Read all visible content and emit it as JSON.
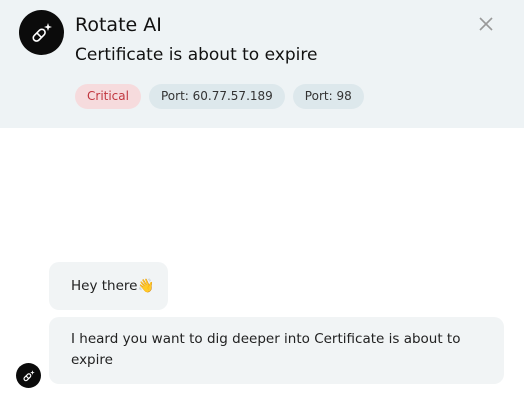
{
  "header": {
    "app_name": "Rotate AI",
    "subtitle": "Certificate is about to expire",
    "logo_icon": "pill-sparkle-icon",
    "close_icon": "close-icon",
    "tags": [
      {
        "label": "Critical",
        "kind": "critical"
      },
      {
        "label": "Port: 60.77.57.189",
        "kind": "info"
      },
      {
        "label": "Port: 98",
        "kind": "info"
      }
    ]
  },
  "chat": {
    "messages": [
      {
        "text": "Hey there👋"
      },
      {
        "text": "I heard you want to dig deeper into Certificate is about to expire"
      }
    ],
    "avatar_icon": "pill-sparkle-icon"
  },
  "colors": {
    "header_bg": "#eef3f5",
    "critical_bg": "#f6dbdd",
    "critical_text": "#c1373f",
    "info_bg": "#dde8ec",
    "bubble_bg": "#f1f4f5"
  }
}
